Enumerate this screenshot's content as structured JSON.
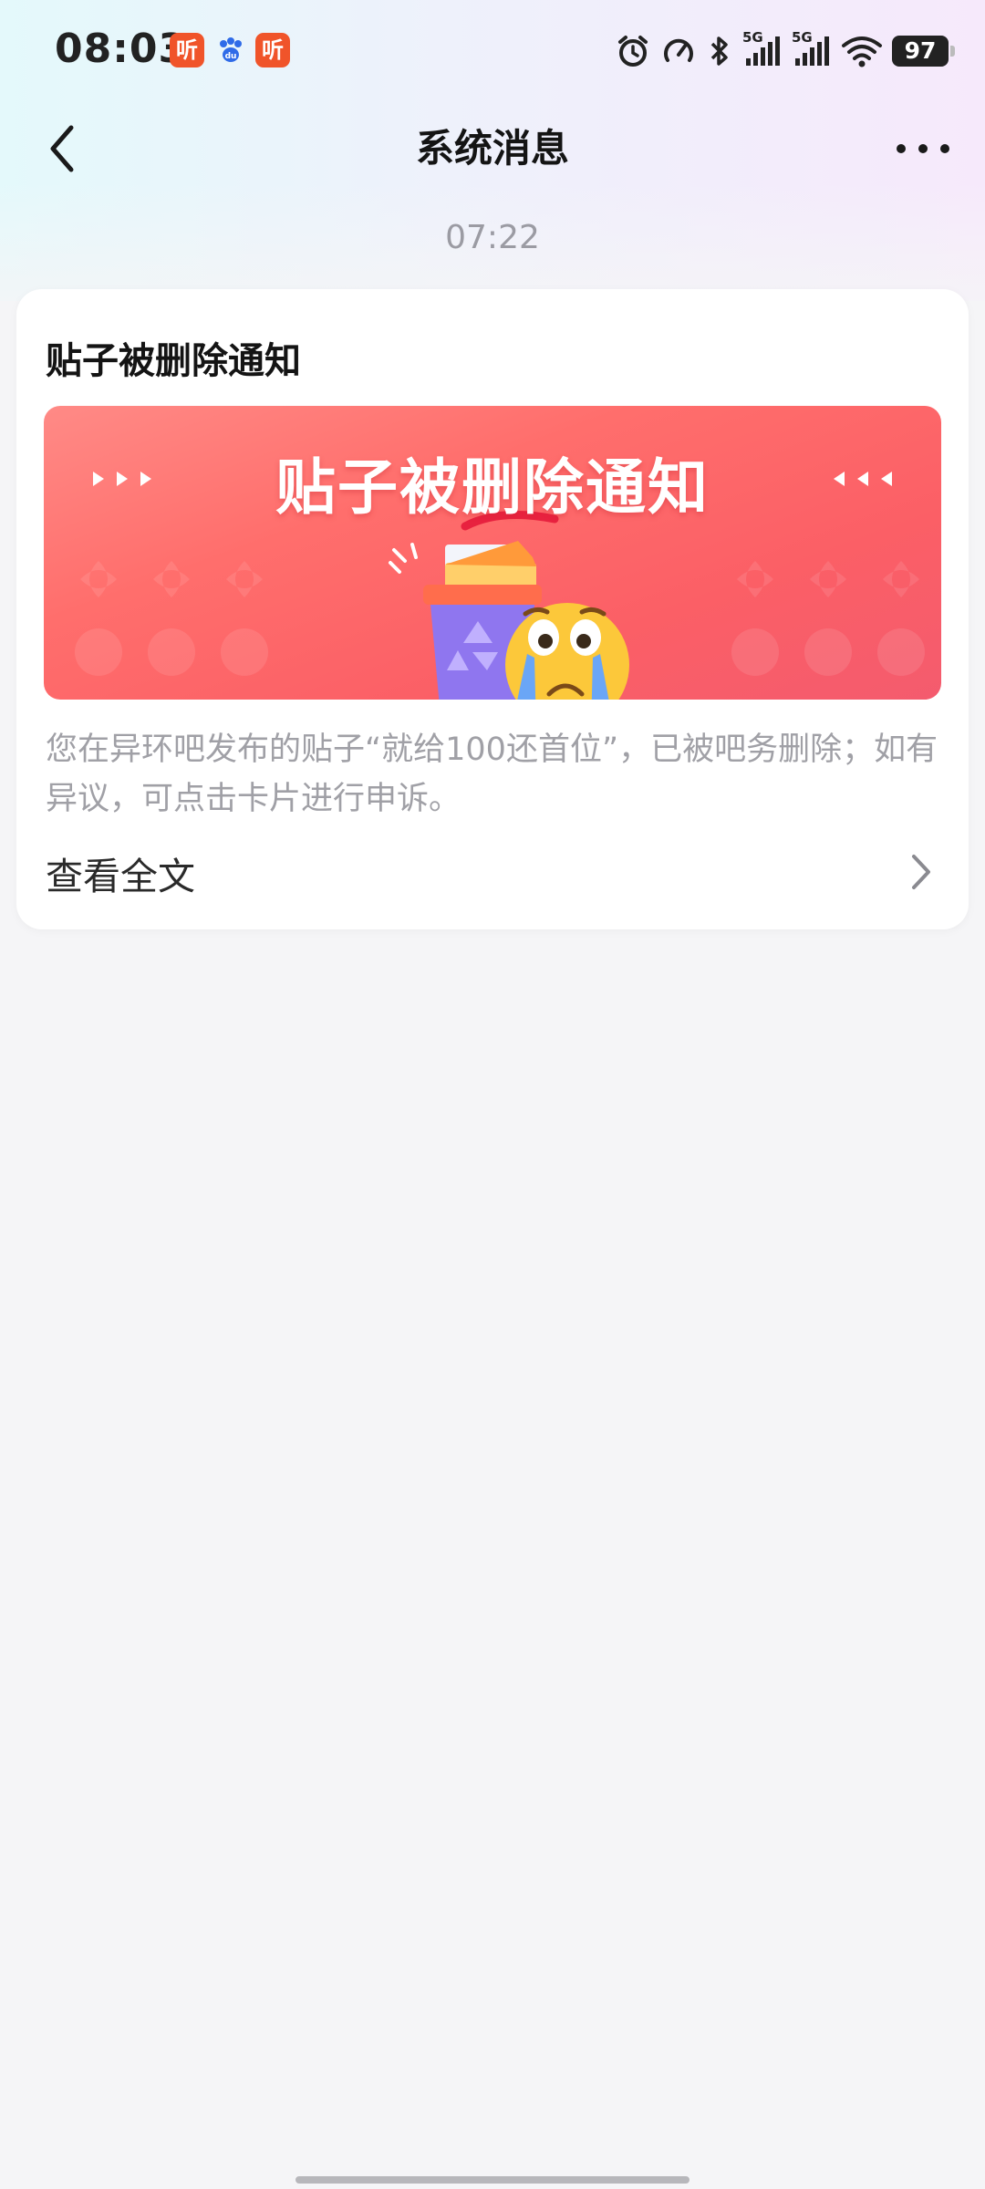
{
  "status_bar": {
    "time": "08:03",
    "app_icons": [
      "听",
      "听"
    ],
    "network_label_1": "5G",
    "network_label_2": "5G",
    "battery": "97"
  },
  "nav": {
    "title": "系统消息"
  },
  "message": {
    "timestamp": "07:22",
    "card_title": "贴子被删除通知",
    "banner_heading": "贴子被删除通知",
    "body": "您在异环吧发布的贴子“就给100还首位”，已被吧务删除；如有异议，可点击卡片进行申诉。",
    "read_more": "查看全文"
  },
  "colors": {
    "banner_red": "#fb5f66",
    "app_orange": "#f0542a",
    "muted_text": "#a0a0a6"
  },
  "icons": [
    "back-arrow-icon",
    "more-icon",
    "alarm-icon",
    "speed-icon",
    "bluetooth-icon",
    "signal-icon",
    "wifi-icon",
    "battery-icon",
    "chevron-right-icon",
    "recycle-bin-illustration",
    "crying-emoji-illustration"
  ]
}
